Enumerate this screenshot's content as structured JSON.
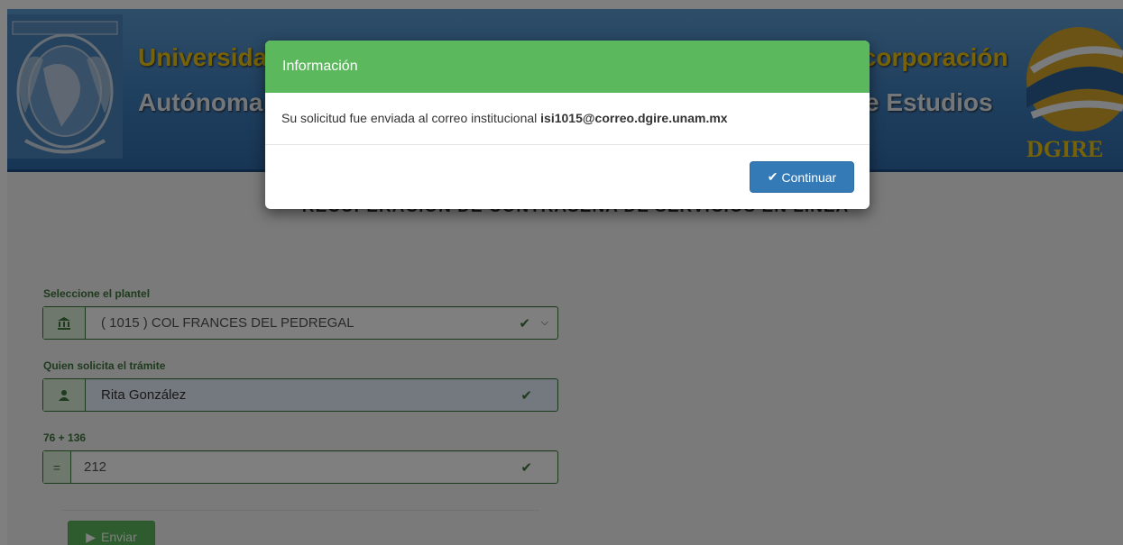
{
  "header": {
    "line1_left": "Universidad Nacional",
    "line2_left": "Autónoma de México",
    "line1_right": "Dirección General de Incorporación",
    "line2_right": "y Revalidación de Estudios",
    "logo_text": "DGIRE"
  },
  "page": {
    "heading": "RECUPERACIÓN DE CONTRASEÑA DE SERVICIOS EN LÍNEA"
  },
  "form": {
    "plantel_label": "Seleccione el plantel",
    "plantel_value": "( 1015 ) COL FRANCES DEL PEDREGAL",
    "solicitante_label": "Quien solicita el trámite",
    "solicitante_value": "Rita González",
    "captcha_label": "76 + 136",
    "captcha_value": "212",
    "captcha_addon": "=",
    "send_label": "Enviar"
  },
  "modal": {
    "title": "Información",
    "message": "Su solicitud fue enviada al correo institucional",
    "email": "isi1015@correo.dgire.unam.mx",
    "continue_label": "Continuar"
  },
  "colors": {
    "success_green": "#5cb85c",
    "primary_blue": "#337ab7",
    "header_blue": "#3f7fbf",
    "header_gold": "#f1c40f"
  },
  "icons": {
    "plantel": "bank-icon",
    "solicitante": "user-icon",
    "valid": "check-icon",
    "dropdown": "chevron-down-icon",
    "send": "play-icon",
    "continue": "check-icon"
  }
}
